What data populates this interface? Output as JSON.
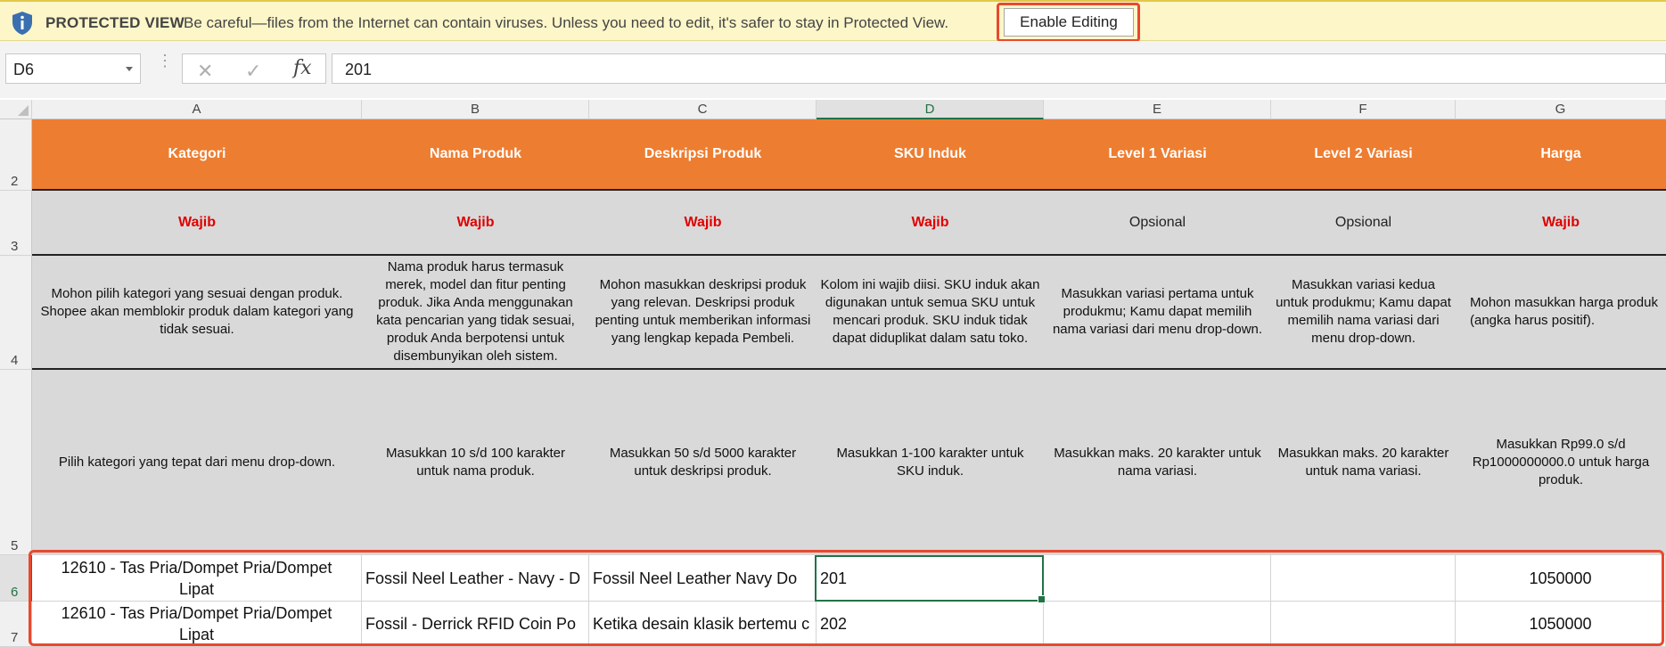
{
  "protected_view": {
    "title": "PROTECTED VIEW",
    "message": "Be careful—files from the Internet can contain viruses. Unless you need to edit, it's safer to stay in Protected View.",
    "button": "Enable Editing"
  },
  "formula_bar": {
    "name_box": "D6",
    "fx": "fx",
    "value": "201"
  },
  "columns": [
    "A",
    "B",
    "C",
    "D",
    "E",
    "F",
    "G"
  ],
  "rows": [
    "2",
    "3",
    "4",
    "5",
    "6",
    "7"
  ],
  "sheet": {
    "headers": [
      "Kategori",
      "Nama Produk",
      "Deskripsi Produk",
      "SKU Induk",
      "Level 1 Variasi",
      "Level 2 Variasi",
      "Harga"
    ],
    "requirement": [
      "Wajib",
      "Wajib",
      "Wajib",
      "Wajib",
      "Opsional",
      "Opsional",
      "Wajib"
    ],
    "descriptions": [
      "Mohon pilih kategori yang sesuai dengan produk. Shopee akan memblokir produk dalam kategori yang tidak sesuai.",
      "Nama produk harus termasuk merek, model dan fitur penting produk. Jika Anda menggunakan kata pencarian yang tidak sesuai, produk Anda berpotensi untuk disembunyikan oleh sistem.",
      "Mohon masukkan deskripsi produk yang relevan. Deskripsi produk penting untuk memberikan informasi yang lengkap kepada Pembeli.",
      "Kolom ini wajib diisi. SKU induk akan digunakan untuk semua SKU untuk mencari produk. SKU induk tidak dapat diduplikat dalam satu toko.",
      "Masukkan variasi pertama untuk produkmu; Kamu dapat memilih nama variasi dari menu drop-down.",
      "Masukkan variasi kedua untuk produkmu; Kamu dapat memilih nama variasi dari menu drop-down.",
      "Mohon masukkan harga produk (angka harus positif)."
    ],
    "rules": [
      "Pilih kategori yang tepat dari menu drop-down.",
      "Masukkan 10 s/d 100 karakter untuk nama produk.",
      "Masukkan 50 s/d 5000 karakter untuk deskripsi produk.",
      "Masukkan 1-100 karakter untuk SKU induk.",
      "Masukkan maks. 20 karakter untuk nama variasi.",
      "Masukkan maks. 20 karakter untuk nama variasi.",
      "Masukkan Rp99.0 s/d Rp1000000000.0 untuk harga produk."
    ],
    "data_rows": [
      [
        "12610 - Tas Pria/Dompet Pria/Dompet Lipat",
        "Fossil Neel Leather - Navy - D",
        "Fossil Neel Leather  Navy  Do",
        "201",
        "",
        "",
        "1050000"
      ],
      [
        "12610 - Tas Pria/Dompet Pria/Dompet Lipat",
        "Fossil - Derrick RFID Coin Po",
        "Ketika desain klasik bertemu c",
        "202",
        "",
        "",
        "1050000"
      ]
    ]
  }
}
